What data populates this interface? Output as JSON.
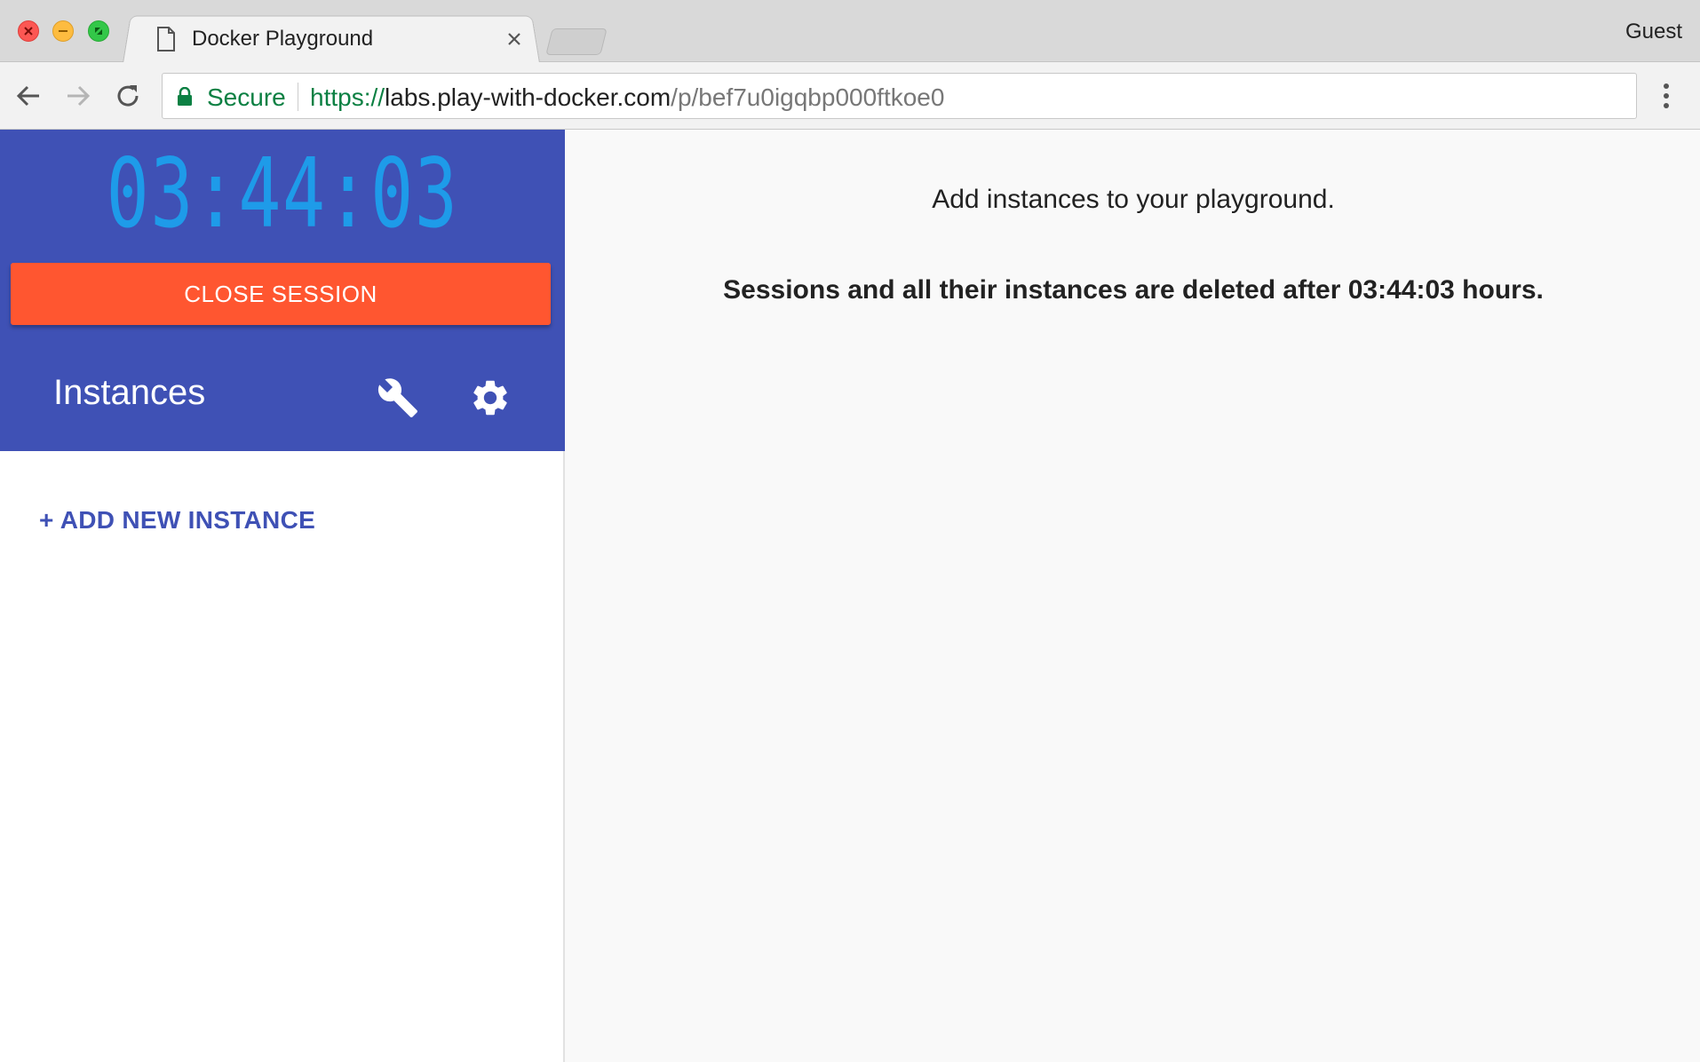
{
  "browser": {
    "tab_title": "Docker Playground",
    "profile": "Guest",
    "secure_label": "Secure",
    "url": {
      "scheme": "https://",
      "host": "labs.play-with-docker.com",
      "path": "/p/bef7u0igqbp000ftkoe0"
    }
  },
  "sidebar": {
    "timer": "03:44:03",
    "close_session_label": "CLOSE SESSION",
    "instances_title": "Instances",
    "add_instance_label": "+ ADD NEW INSTANCE"
  },
  "main": {
    "message": "Add instances to your playground.",
    "warning": "Sessions and all their instances are deleted after 03:44:03 hours."
  },
  "colors": {
    "sidebar_header": "#3f51b5",
    "timer": "#1e9be9",
    "close_session": "#ff5630",
    "secure": "#0b8043"
  }
}
